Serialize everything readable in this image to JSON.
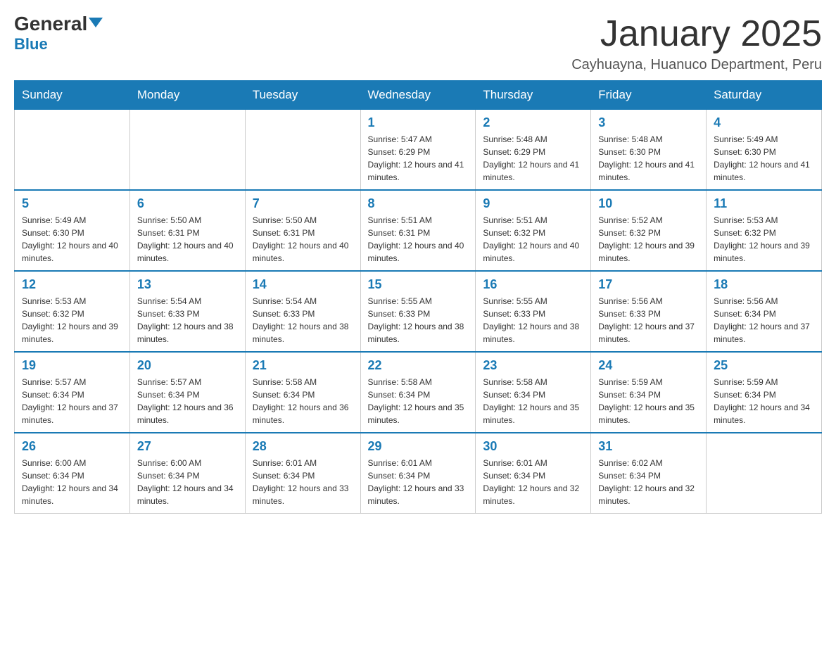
{
  "logo": {
    "name_part1": "General",
    "name_part2": "Blue"
  },
  "header": {
    "month": "January 2025",
    "location": "Cayhuayna, Huanuco Department, Peru"
  },
  "weekdays": [
    "Sunday",
    "Monday",
    "Tuesday",
    "Wednesday",
    "Thursday",
    "Friday",
    "Saturday"
  ],
  "weeks": [
    [
      {
        "day": "",
        "info": ""
      },
      {
        "day": "",
        "info": ""
      },
      {
        "day": "",
        "info": ""
      },
      {
        "day": "1",
        "info": "Sunrise: 5:47 AM\nSunset: 6:29 PM\nDaylight: 12 hours and 41 minutes."
      },
      {
        "day": "2",
        "info": "Sunrise: 5:48 AM\nSunset: 6:29 PM\nDaylight: 12 hours and 41 minutes."
      },
      {
        "day": "3",
        "info": "Sunrise: 5:48 AM\nSunset: 6:30 PM\nDaylight: 12 hours and 41 minutes."
      },
      {
        "day": "4",
        "info": "Sunrise: 5:49 AM\nSunset: 6:30 PM\nDaylight: 12 hours and 41 minutes."
      }
    ],
    [
      {
        "day": "5",
        "info": "Sunrise: 5:49 AM\nSunset: 6:30 PM\nDaylight: 12 hours and 40 minutes."
      },
      {
        "day": "6",
        "info": "Sunrise: 5:50 AM\nSunset: 6:31 PM\nDaylight: 12 hours and 40 minutes."
      },
      {
        "day": "7",
        "info": "Sunrise: 5:50 AM\nSunset: 6:31 PM\nDaylight: 12 hours and 40 minutes."
      },
      {
        "day": "8",
        "info": "Sunrise: 5:51 AM\nSunset: 6:31 PM\nDaylight: 12 hours and 40 minutes."
      },
      {
        "day": "9",
        "info": "Sunrise: 5:51 AM\nSunset: 6:32 PM\nDaylight: 12 hours and 40 minutes."
      },
      {
        "day": "10",
        "info": "Sunrise: 5:52 AM\nSunset: 6:32 PM\nDaylight: 12 hours and 39 minutes."
      },
      {
        "day": "11",
        "info": "Sunrise: 5:53 AM\nSunset: 6:32 PM\nDaylight: 12 hours and 39 minutes."
      }
    ],
    [
      {
        "day": "12",
        "info": "Sunrise: 5:53 AM\nSunset: 6:32 PM\nDaylight: 12 hours and 39 minutes."
      },
      {
        "day": "13",
        "info": "Sunrise: 5:54 AM\nSunset: 6:33 PM\nDaylight: 12 hours and 38 minutes."
      },
      {
        "day": "14",
        "info": "Sunrise: 5:54 AM\nSunset: 6:33 PM\nDaylight: 12 hours and 38 minutes."
      },
      {
        "day": "15",
        "info": "Sunrise: 5:55 AM\nSunset: 6:33 PM\nDaylight: 12 hours and 38 minutes."
      },
      {
        "day": "16",
        "info": "Sunrise: 5:55 AM\nSunset: 6:33 PM\nDaylight: 12 hours and 38 minutes."
      },
      {
        "day": "17",
        "info": "Sunrise: 5:56 AM\nSunset: 6:33 PM\nDaylight: 12 hours and 37 minutes."
      },
      {
        "day": "18",
        "info": "Sunrise: 5:56 AM\nSunset: 6:34 PM\nDaylight: 12 hours and 37 minutes."
      }
    ],
    [
      {
        "day": "19",
        "info": "Sunrise: 5:57 AM\nSunset: 6:34 PM\nDaylight: 12 hours and 37 minutes."
      },
      {
        "day": "20",
        "info": "Sunrise: 5:57 AM\nSunset: 6:34 PM\nDaylight: 12 hours and 36 minutes."
      },
      {
        "day": "21",
        "info": "Sunrise: 5:58 AM\nSunset: 6:34 PM\nDaylight: 12 hours and 36 minutes."
      },
      {
        "day": "22",
        "info": "Sunrise: 5:58 AM\nSunset: 6:34 PM\nDaylight: 12 hours and 35 minutes."
      },
      {
        "day": "23",
        "info": "Sunrise: 5:58 AM\nSunset: 6:34 PM\nDaylight: 12 hours and 35 minutes."
      },
      {
        "day": "24",
        "info": "Sunrise: 5:59 AM\nSunset: 6:34 PM\nDaylight: 12 hours and 35 minutes."
      },
      {
        "day": "25",
        "info": "Sunrise: 5:59 AM\nSunset: 6:34 PM\nDaylight: 12 hours and 34 minutes."
      }
    ],
    [
      {
        "day": "26",
        "info": "Sunrise: 6:00 AM\nSunset: 6:34 PM\nDaylight: 12 hours and 34 minutes."
      },
      {
        "day": "27",
        "info": "Sunrise: 6:00 AM\nSunset: 6:34 PM\nDaylight: 12 hours and 34 minutes."
      },
      {
        "day": "28",
        "info": "Sunrise: 6:01 AM\nSunset: 6:34 PM\nDaylight: 12 hours and 33 minutes."
      },
      {
        "day": "29",
        "info": "Sunrise: 6:01 AM\nSunset: 6:34 PM\nDaylight: 12 hours and 33 minutes."
      },
      {
        "day": "30",
        "info": "Sunrise: 6:01 AM\nSunset: 6:34 PM\nDaylight: 12 hours and 32 minutes."
      },
      {
        "day": "31",
        "info": "Sunrise: 6:02 AM\nSunset: 6:34 PM\nDaylight: 12 hours and 32 minutes."
      },
      {
        "day": "",
        "info": ""
      }
    ]
  ]
}
